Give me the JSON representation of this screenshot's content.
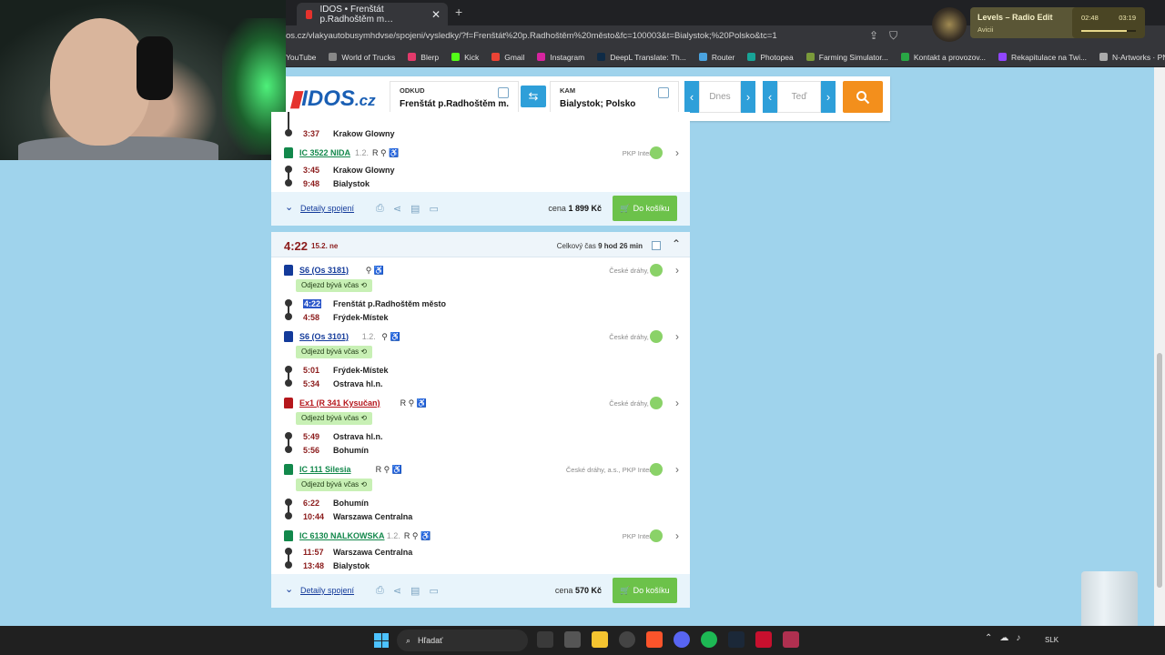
{
  "browser": {
    "tab_title": "IDOS • Frenštát p.Radhoštěm m…",
    "tab_close": "✕",
    "new_tab": "+",
    "url": "os.cz/vlakyautobusymhdvse/spojeni/vysledky/?f=Frenštát%20p.Radhoštěm%20město&fc=100003&t=Bialystok;%20Polsko&tc=1",
    "bookmarks": [
      "YouTube",
      "World of Trucks",
      "Blerp",
      "Kick",
      "Gmail",
      "Instagram",
      "DeepL Translate: Th...",
      "Router",
      "Photopea",
      "Farming Simulator...",
      "Kontakt a provozov...",
      "Rekapitulace na Twi...",
      "N-Artworks · PNG"
    ]
  },
  "music": {
    "title": "Levels – Radio Edit",
    "artist": "Avicii",
    "elapsed": "02:48",
    "total": "03:19",
    "progress": 0.84
  },
  "site": {
    "logo_text": "IDOS",
    "logo_tld": ".cz",
    "from_label": "ODKUD",
    "from_value": "Frenštát p.Radhoštěm m...",
    "to_label": "KAM",
    "to_value": "Bialystok; Polsko",
    "swap_glyph": "⇆",
    "date_value": "Dnes",
    "time_value": "Teď",
    "prev_glyph": "‹",
    "next_glyph": "›",
    "search_glyph": "⌕"
  },
  "first_connection": {
    "partial_time": "3:37",
    "partial_stop": "Krakow Glowny",
    "train": {
      "name": "IC 3522 NIDA",
      "platform": "1.2.",
      "tags": "R",
      "carrier": "PKP Intercity",
      "stops": [
        {
          "time": "3:45",
          "name": "Krakow Glowny"
        },
        {
          "time": "9:48",
          "name": "Bialystok"
        }
      ]
    },
    "details_label": "Detaily spojení",
    "price_label": "cena",
    "price": "1 899 Kč",
    "cart_label": "Do košíku"
  },
  "second_connection": {
    "dep_time": "4:22",
    "date": "15.2. ne",
    "total_label": "Celkový čas",
    "total_value": "9 hod 26 min",
    "ontime_label": "Odjezd bývá včas",
    "legs": [
      {
        "name": "S6 (Os 3181)",
        "platform": "",
        "tags": "",
        "carrier": "České dráhy, a.s.",
        "color": "blue",
        "ontime": true,
        "stops": [
          {
            "time": "4:22",
            "name": "Frenštát p.Radhoštěm město"
          },
          {
            "time": "4:58",
            "name": "Frýdek-Místek"
          }
        ]
      },
      {
        "name": "S6 (Os 3101)",
        "platform": "1.2.",
        "tags": "",
        "carrier": "České dráhy, a.s.",
        "color": "blue",
        "ontime": true,
        "stops": [
          {
            "time": "5:01",
            "name": "Frýdek-Místek"
          },
          {
            "time": "5:34",
            "name": "Ostrava hl.n."
          }
        ]
      },
      {
        "name": "Ex1 (R 341 Kysučan)",
        "platform": "",
        "tags": "R",
        "carrier": "České dráhy, a.s.",
        "color": "red",
        "ontime": true,
        "stops": [
          {
            "time": "5:49",
            "name": "Ostrava hl.n."
          },
          {
            "time": "5:56",
            "name": "Bohumín"
          }
        ]
      },
      {
        "name": "IC 111 Silesia",
        "platform": "",
        "tags": "R",
        "carrier": "České dráhy, a.s., PKP Intercity",
        "color": "green",
        "ontime": true,
        "stops": [
          {
            "time": "6:22",
            "name": "Bohumín"
          },
          {
            "time": "10:44",
            "name": "Warszawa Centralna"
          }
        ]
      },
      {
        "name": "IC 6130 NALKOWSKA",
        "platform": "1.2.",
        "tags": "R",
        "carrier": "PKP Intercity",
        "color": "green",
        "ontime": false,
        "stops": [
          {
            "time": "11:57",
            "name": "Warszawa Centralna"
          },
          {
            "time": "13:48",
            "name": "Bialystok"
          }
        ]
      }
    ],
    "details_label": "Detaily spojení",
    "price_label": "cena",
    "price": "570 Kč",
    "cart_label": "Do košíku"
  },
  "taskbar": {
    "search_label": "Hľadať",
    "lang": "SLK"
  },
  "colors": {
    "accent_blue": "#2e9fd9",
    "search_orange": "#f38f1c",
    "cart_green": "#6cc24a",
    "time_red": "#8b1b1b"
  }
}
